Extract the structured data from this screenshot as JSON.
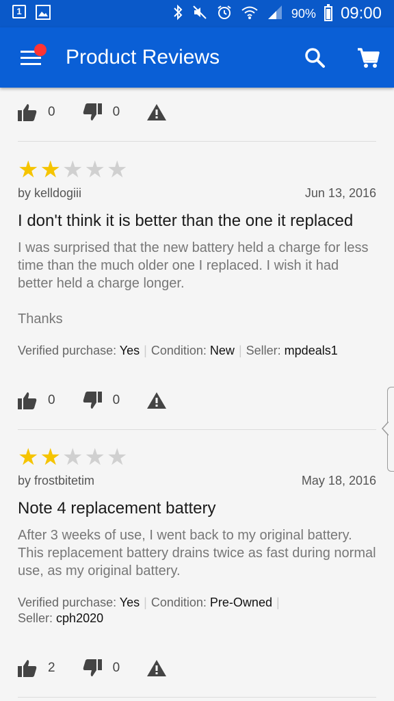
{
  "status_bar": {
    "battery": "90%",
    "time": "09:00",
    "notif_box_label": "1"
  },
  "app_bar": {
    "title": "Product Reviews"
  },
  "top_actions": {
    "likes": "0",
    "dislikes": "0"
  },
  "reviews": [
    {
      "rating": 2,
      "author": "by kelldogiii",
      "date": "Jun 13, 2016",
      "title": "I don't think it is better than the one it replaced",
      "body": "I was surprised that the new battery held a charge for less time than the much older one I replaced. I wish it had better held a charge longer.\n\nThanks",
      "verified_label": "Verified purchase:",
      "verified": "Yes",
      "condition_label": "Condition:",
      "condition": "New",
      "seller_label": "Seller:",
      "seller": "mpdeals1",
      "likes": "0",
      "dislikes": "0"
    },
    {
      "rating": 2,
      "author": "by frostbitetim",
      "date": "May 18, 2016",
      "title": "Note 4 replacement battery",
      "body": "After 3 weeks of use, I went back to my original battery. This replacement battery drains twice as fast during normal use, as my original battery.",
      "verified_label": "Verified purchase:",
      "verified": "Yes",
      "condition_label": "Condition:",
      "condition": "Pre-Owned",
      "seller_label": "Seller:",
      "seller": "cph2020",
      "likes": "2",
      "dislikes": "0"
    }
  ],
  "colors": {
    "status_bar": "#0a59c9",
    "app_bar": "#0a5fd6",
    "star_on": "#f5c400",
    "star_off": "#d0d0d0",
    "notification_dot": "#ff3333"
  },
  "icons": [
    "menu-icon",
    "search-icon",
    "cart-icon",
    "thumbs-up-icon",
    "thumbs-down-icon",
    "warning-icon",
    "bluetooth-icon",
    "mute-icon",
    "alarm-icon",
    "wifi-icon",
    "signal-icon",
    "battery-icon"
  ]
}
